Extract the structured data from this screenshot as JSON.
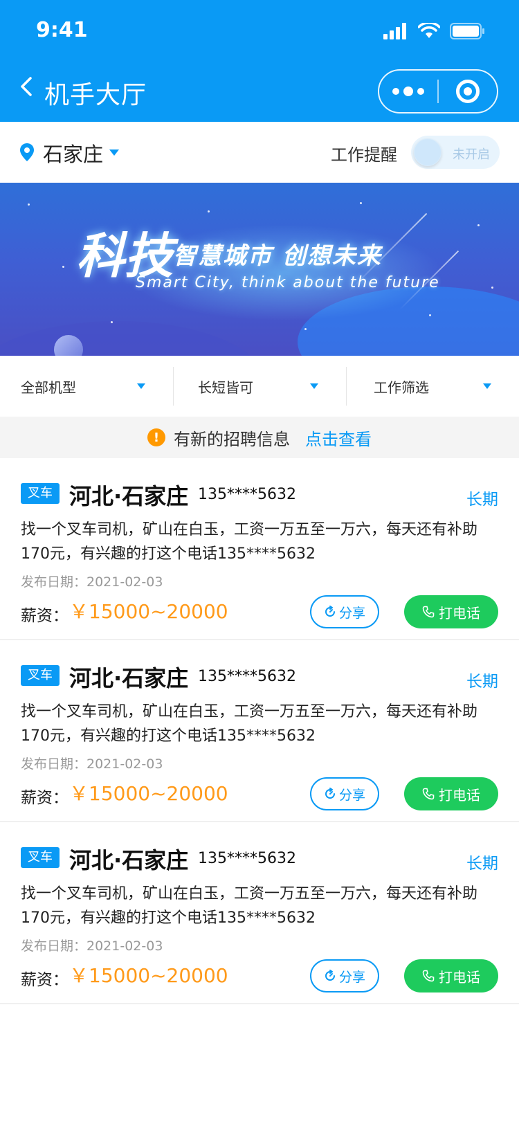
{
  "status_bar": {
    "time": "9:41"
  },
  "nav": {
    "title": "机手大厅"
  },
  "location": {
    "city": "石家庄",
    "remind_label": "工作提醒",
    "toggle_text": "未开启"
  },
  "banner": {
    "main": "科技",
    "sub": "智慧城市  创想未来",
    "english": "Smart City, think about the future"
  },
  "filters": [
    "全部机型",
    "长短皆可",
    "工作筛选"
  ],
  "notice": {
    "icon": "!",
    "text": "有新的招聘信息",
    "link": "点击查看"
  },
  "jobs": [
    {
      "tag": "叉车",
      "location": "河北·石家庄",
      "phone": "135****5632",
      "term": "长期",
      "desc": "找一个叉车司机，矿山在白玉，工资一万五至一万六，每天还有补助170元，有兴趣的打这个电话135****5632",
      "date": "发布日期：2021-02-03",
      "salary_label": "薪资：",
      "salary": "￥15000~20000",
      "share": "分享",
      "call": "打电话"
    },
    {
      "tag": "叉车",
      "location": "河北·石家庄",
      "phone": "135****5632",
      "term": "长期",
      "desc": "找一个叉车司机，矿山在白玉，工资一万五至一万六，每天还有补助170元，有兴趣的打这个电话135****5632",
      "date": "发布日期：2021-02-03",
      "salary_label": "薪资：",
      "salary": "￥15000~20000",
      "share": "分享",
      "call": "打电话"
    },
    {
      "tag": "叉车",
      "location": "河北·石家庄",
      "phone": "135****5632",
      "term": "长期",
      "desc": "找一个叉车司机，矿山在白玉，工资一万五至一万六，每天还有补助170元，有兴趣的打这个电话135****5632",
      "date": "发布日期：2021-02-03",
      "salary_label": "薪资：",
      "salary": "￥15000~20000",
      "share": "分享",
      "call": "打电话"
    }
  ]
}
